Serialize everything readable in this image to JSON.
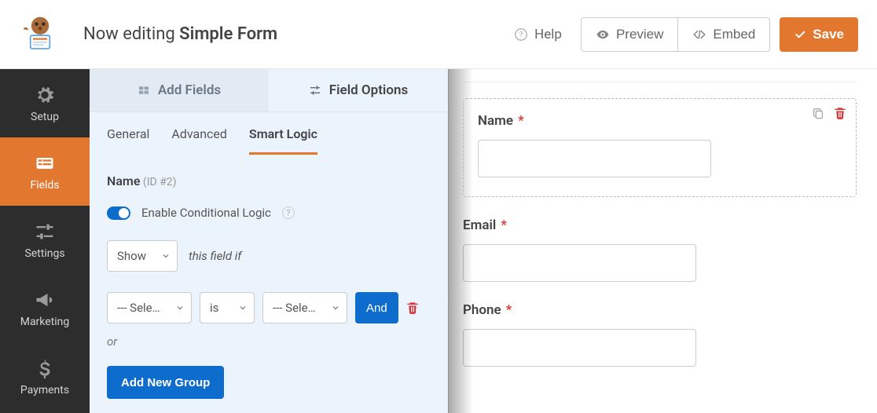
{
  "header": {
    "edit_label": "Now editing ",
    "form_name": "Simple Form",
    "help": "Help",
    "preview": "Preview",
    "embed": "Embed",
    "save": "Save"
  },
  "sidebar": {
    "setup": "Setup",
    "fields": "Fields",
    "settings": "Settings",
    "marketing": "Marketing",
    "payments": "Payments"
  },
  "panel": {
    "tabs": {
      "add_fields": "Add Fields",
      "field_options": "Field Options"
    },
    "subtabs": {
      "general": "General",
      "advanced": "Advanced",
      "smart_logic": "Smart Logic"
    },
    "field_name": "Name",
    "field_id": "(ID #2)",
    "enable_cond": "Enable Conditional Logic",
    "action_select": "Show",
    "this_field_if": "this field if",
    "field_select": "--- Sele…",
    "operator_select": "is",
    "value_select": "--- Sele…",
    "and": "And",
    "or": "or",
    "add_group": "Add New Group"
  },
  "preview": {
    "fields": [
      {
        "label": "Name",
        "required": true,
        "selected": true
      },
      {
        "label": "Email",
        "required": true,
        "selected": false
      },
      {
        "label": "Phone",
        "required": true,
        "selected": false
      }
    ]
  }
}
